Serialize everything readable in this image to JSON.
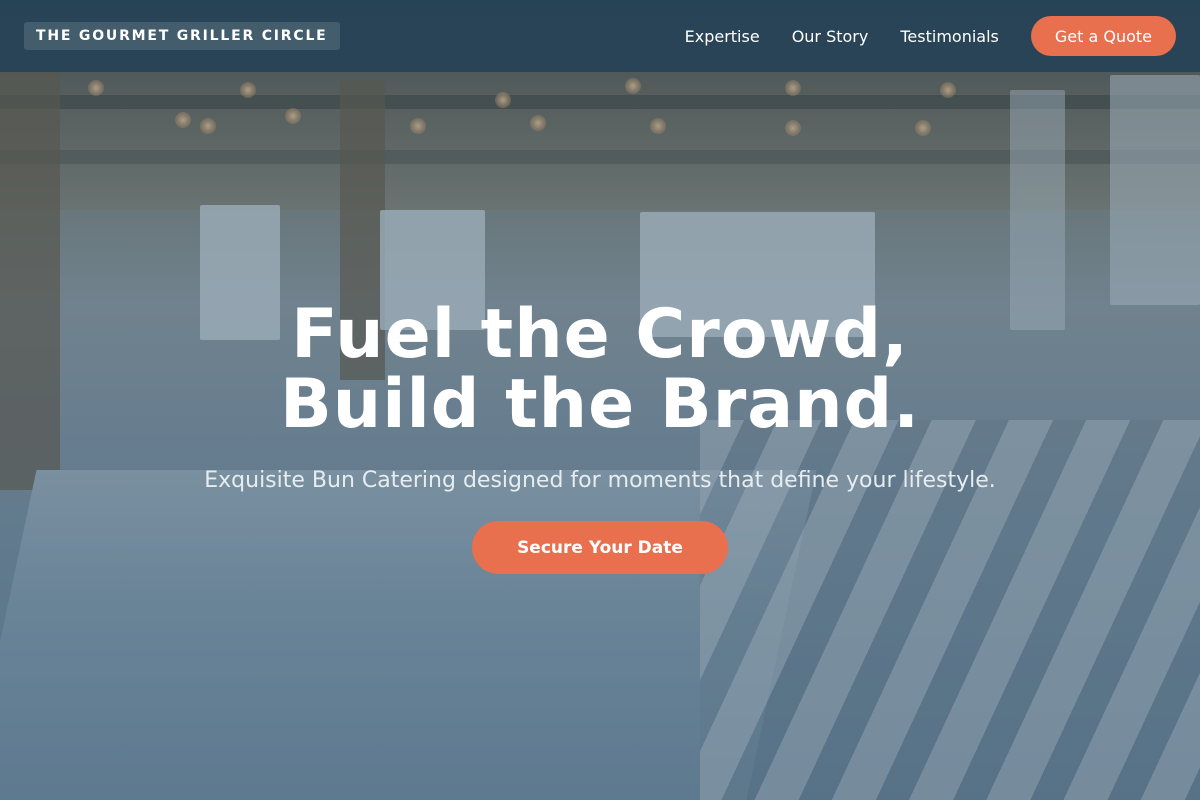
{
  "nav": {
    "brand": "THE GOURMET GRILLER CIRCLE",
    "links": [
      "Expertise",
      "Our Story",
      "Testimonials"
    ],
    "cta_label": "Get a Quote"
  },
  "hero": {
    "title_line1": "Fuel the Crowd,",
    "title_line2": "Build the Brand.",
    "subtitle": "Exquisite Bun Catering designed for moments that define your lifestyle.",
    "cta_label": "Secure Your Date"
  },
  "colors": {
    "nav_bg": "#264356",
    "accent": "#e8704f",
    "text": "#ffffff"
  }
}
